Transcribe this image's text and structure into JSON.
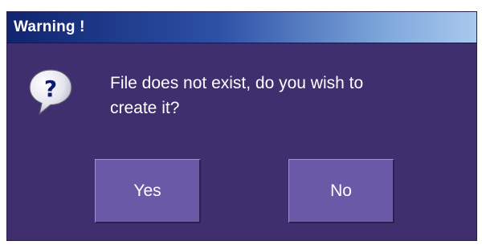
{
  "dialog": {
    "title": "Warning !",
    "icon": "question-icon",
    "message_line1": "File does not exist, do you wish to",
    "message_line2": "create it?",
    "buttons": {
      "yes_label": "Yes",
      "no_label": "No"
    }
  },
  "colors": {
    "dialog_background": "#3f2f6e",
    "title_bar_start": "#10246e",
    "title_bar_end": "#a9c9ee",
    "button_face": "#6a59a6",
    "text": "#ffffff"
  }
}
